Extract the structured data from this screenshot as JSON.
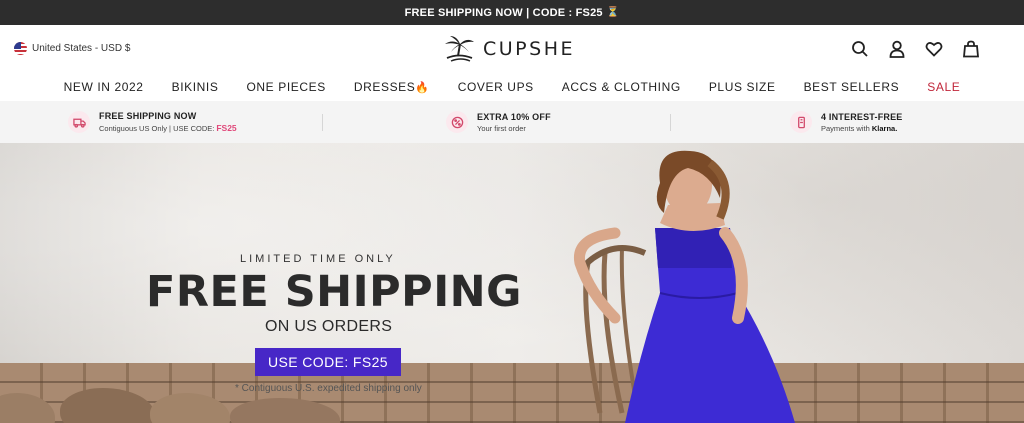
{
  "topbar": {
    "text": "FREE SHIPPING NOW | CODE : FS25"
  },
  "header": {
    "locale": "United States - USD $",
    "logo": "CUPSHE",
    "icons": [
      "search-icon",
      "account-icon",
      "wishlist-heart-icon",
      "shopping-bag-icon"
    ]
  },
  "nav": {
    "items": [
      "NEW IN 2022",
      "BIKINIS",
      "ONE PIECES",
      "DRESSES",
      "COVER UPS",
      "ACCS & CLOTHING",
      "PLUS SIZE",
      "BEST SELLERS",
      "SALE"
    ]
  },
  "benefits": [
    {
      "title": "FREE SHIPPING NOW",
      "detail": "Contiguous US Only | USE CODE:",
      "code": "FS25"
    },
    {
      "title": "EXTRA 10% OFF",
      "detail": "Your first order"
    },
    {
      "title": "4 INTEREST-FREE",
      "detail": "Payments with",
      "brand": "Klarna."
    }
  ],
  "hero": {
    "eyebrow": "LIMITED TIME ONLY",
    "headline": "FREE SHIPPING",
    "subheadline": "ON US ORDERS",
    "cta": "USE CODE: FS25",
    "footnote": "* Contiguous U.S. expedited shipping only"
  },
  "colors": {
    "topbar_bg": "#2d2d2d",
    "sale": "#c0263a",
    "cta_bg": "#4727c7",
    "code_pink": "#e0487a",
    "dress": "#3d2bd4"
  }
}
